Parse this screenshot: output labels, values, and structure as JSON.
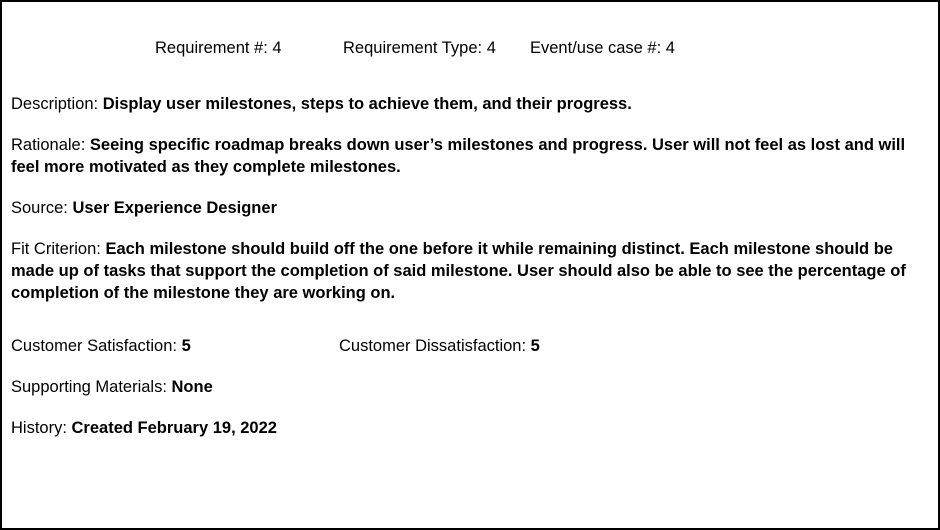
{
  "header": {
    "requirement_number_label": "Requirement #:",
    "requirement_number_value": "4",
    "requirement_type_label": "Requirement Type:",
    "requirement_type_value": "4",
    "event_use_case_label": "Event/use case #:",
    "event_use_case_value": "4"
  },
  "description": {
    "label": "Description:",
    "value": "Display user milestones, steps to achieve them, and their progress."
  },
  "rationale": {
    "label": "Rationale:",
    "value": "Seeing specific roadmap breaks down user’s milestones and progress. User will not feel as lost and will feel more motivated as they complete milestones."
  },
  "source": {
    "label": "Source:",
    "value": "User Experience Designer"
  },
  "fit_criterion": {
    "label": "Fit Criterion:",
    "value": "Each milestone should build off the one before it while remaining distinct. Each milestone should be made up of tasks that support the completion of said milestone. User should also be able to see the percentage of completion of the milestone they are working on."
  },
  "customer_satisfaction": {
    "label": "Customer Satisfaction:",
    "value": "5"
  },
  "customer_dissatisfaction": {
    "label": "Customer Dissatisfaction:",
    "value": "5"
  },
  "supporting_materials": {
    "label": "Supporting Materials:",
    "value": "None"
  },
  "history": {
    "label": "History:",
    "value": "Created February 19, 2022"
  }
}
